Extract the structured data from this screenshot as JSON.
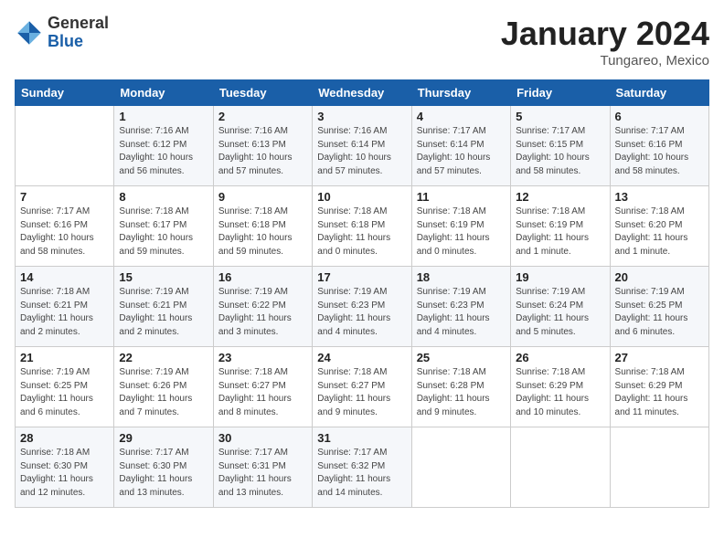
{
  "header": {
    "logo_general": "General",
    "logo_blue": "Blue",
    "title": "January 2024",
    "location": "Tungareo, Mexico"
  },
  "days_of_week": [
    "Sunday",
    "Monday",
    "Tuesday",
    "Wednesday",
    "Thursday",
    "Friday",
    "Saturday"
  ],
  "weeks": [
    [
      {
        "day": "",
        "info": ""
      },
      {
        "day": "1",
        "info": "Sunrise: 7:16 AM\nSunset: 6:12 PM\nDaylight: 10 hours\nand 56 minutes."
      },
      {
        "day": "2",
        "info": "Sunrise: 7:16 AM\nSunset: 6:13 PM\nDaylight: 10 hours\nand 57 minutes."
      },
      {
        "day": "3",
        "info": "Sunrise: 7:16 AM\nSunset: 6:14 PM\nDaylight: 10 hours\nand 57 minutes."
      },
      {
        "day": "4",
        "info": "Sunrise: 7:17 AM\nSunset: 6:14 PM\nDaylight: 10 hours\nand 57 minutes."
      },
      {
        "day": "5",
        "info": "Sunrise: 7:17 AM\nSunset: 6:15 PM\nDaylight: 10 hours\nand 58 minutes."
      },
      {
        "day": "6",
        "info": "Sunrise: 7:17 AM\nSunset: 6:16 PM\nDaylight: 10 hours\nand 58 minutes."
      }
    ],
    [
      {
        "day": "7",
        "info": "Sunrise: 7:17 AM\nSunset: 6:16 PM\nDaylight: 10 hours\nand 58 minutes."
      },
      {
        "day": "8",
        "info": "Sunrise: 7:18 AM\nSunset: 6:17 PM\nDaylight: 10 hours\nand 59 minutes."
      },
      {
        "day": "9",
        "info": "Sunrise: 7:18 AM\nSunset: 6:18 PM\nDaylight: 10 hours\nand 59 minutes."
      },
      {
        "day": "10",
        "info": "Sunrise: 7:18 AM\nSunset: 6:18 PM\nDaylight: 11 hours\nand 0 minutes."
      },
      {
        "day": "11",
        "info": "Sunrise: 7:18 AM\nSunset: 6:19 PM\nDaylight: 11 hours\nand 0 minutes."
      },
      {
        "day": "12",
        "info": "Sunrise: 7:18 AM\nSunset: 6:19 PM\nDaylight: 11 hours\nand 1 minute."
      },
      {
        "day": "13",
        "info": "Sunrise: 7:18 AM\nSunset: 6:20 PM\nDaylight: 11 hours\nand 1 minute."
      }
    ],
    [
      {
        "day": "14",
        "info": "Sunrise: 7:18 AM\nSunset: 6:21 PM\nDaylight: 11 hours\nand 2 minutes."
      },
      {
        "day": "15",
        "info": "Sunrise: 7:19 AM\nSunset: 6:21 PM\nDaylight: 11 hours\nand 2 minutes."
      },
      {
        "day": "16",
        "info": "Sunrise: 7:19 AM\nSunset: 6:22 PM\nDaylight: 11 hours\nand 3 minutes."
      },
      {
        "day": "17",
        "info": "Sunrise: 7:19 AM\nSunset: 6:23 PM\nDaylight: 11 hours\nand 4 minutes."
      },
      {
        "day": "18",
        "info": "Sunrise: 7:19 AM\nSunset: 6:23 PM\nDaylight: 11 hours\nand 4 minutes."
      },
      {
        "day": "19",
        "info": "Sunrise: 7:19 AM\nSunset: 6:24 PM\nDaylight: 11 hours\nand 5 minutes."
      },
      {
        "day": "20",
        "info": "Sunrise: 7:19 AM\nSunset: 6:25 PM\nDaylight: 11 hours\nand 6 minutes."
      }
    ],
    [
      {
        "day": "21",
        "info": "Sunrise: 7:19 AM\nSunset: 6:25 PM\nDaylight: 11 hours\nand 6 minutes."
      },
      {
        "day": "22",
        "info": "Sunrise: 7:19 AM\nSunset: 6:26 PM\nDaylight: 11 hours\nand 7 minutes."
      },
      {
        "day": "23",
        "info": "Sunrise: 7:18 AM\nSunset: 6:27 PM\nDaylight: 11 hours\nand 8 minutes."
      },
      {
        "day": "24",
        "info": "Sunrise: 7:18 AM\nSunset: 6:27 PM\nDaylight: 11 hours\nand 9 minutes."
      },
      {
        "day": "25",
        "info": "Sunrise: 7:18 AM\nSunset: 6:28 PM\nDaylight: 11 hours\nand 9 minutes."
      },
      {
        "day": "26",
        "info": "Sunrise: 7:18 AM\nSunset: 6:29 PM\nDaylight: 11 hours\nand 10 minutes."
      },
      {
        "day": "27",
        "info": "Sunrise: 7:18 AM\nSunset: 6:29 PM\nDaylight: 11 hours\nand 11 minutes."
      }
    ],
    [
      {
        "day": "28",
        "info": "Sunrise: 7:18 AM\nSunset: 6:30 PM\nDaylight: 11 hours\nand 12 minutes."
      },
      {
        "day": "29",
        "info": "Sunrise: 7:17 AM\nSunset: 6:30 PM\nDaylight: 11 hours\nand 13 minutes."
      },
      {
        "day": "30",
        "info": "Sunrise: 7:17 AM\nSunset: 6:31 PM\nDaylight: 11 hours\nand 13 minutes."
      },
      {
        "day": "31",
        "info": "Sunrise: 7:17 AM\nSunset: 6:32 PM\nDaylight: 11 hours\nand 14 minutes."
      },
      {
        "day": "",
        "info": ""
      },
      {
        "day": "",
        "info": ""
      },
      {
        "day": "",
        "info": ""
      }
    ]
  ]
}
